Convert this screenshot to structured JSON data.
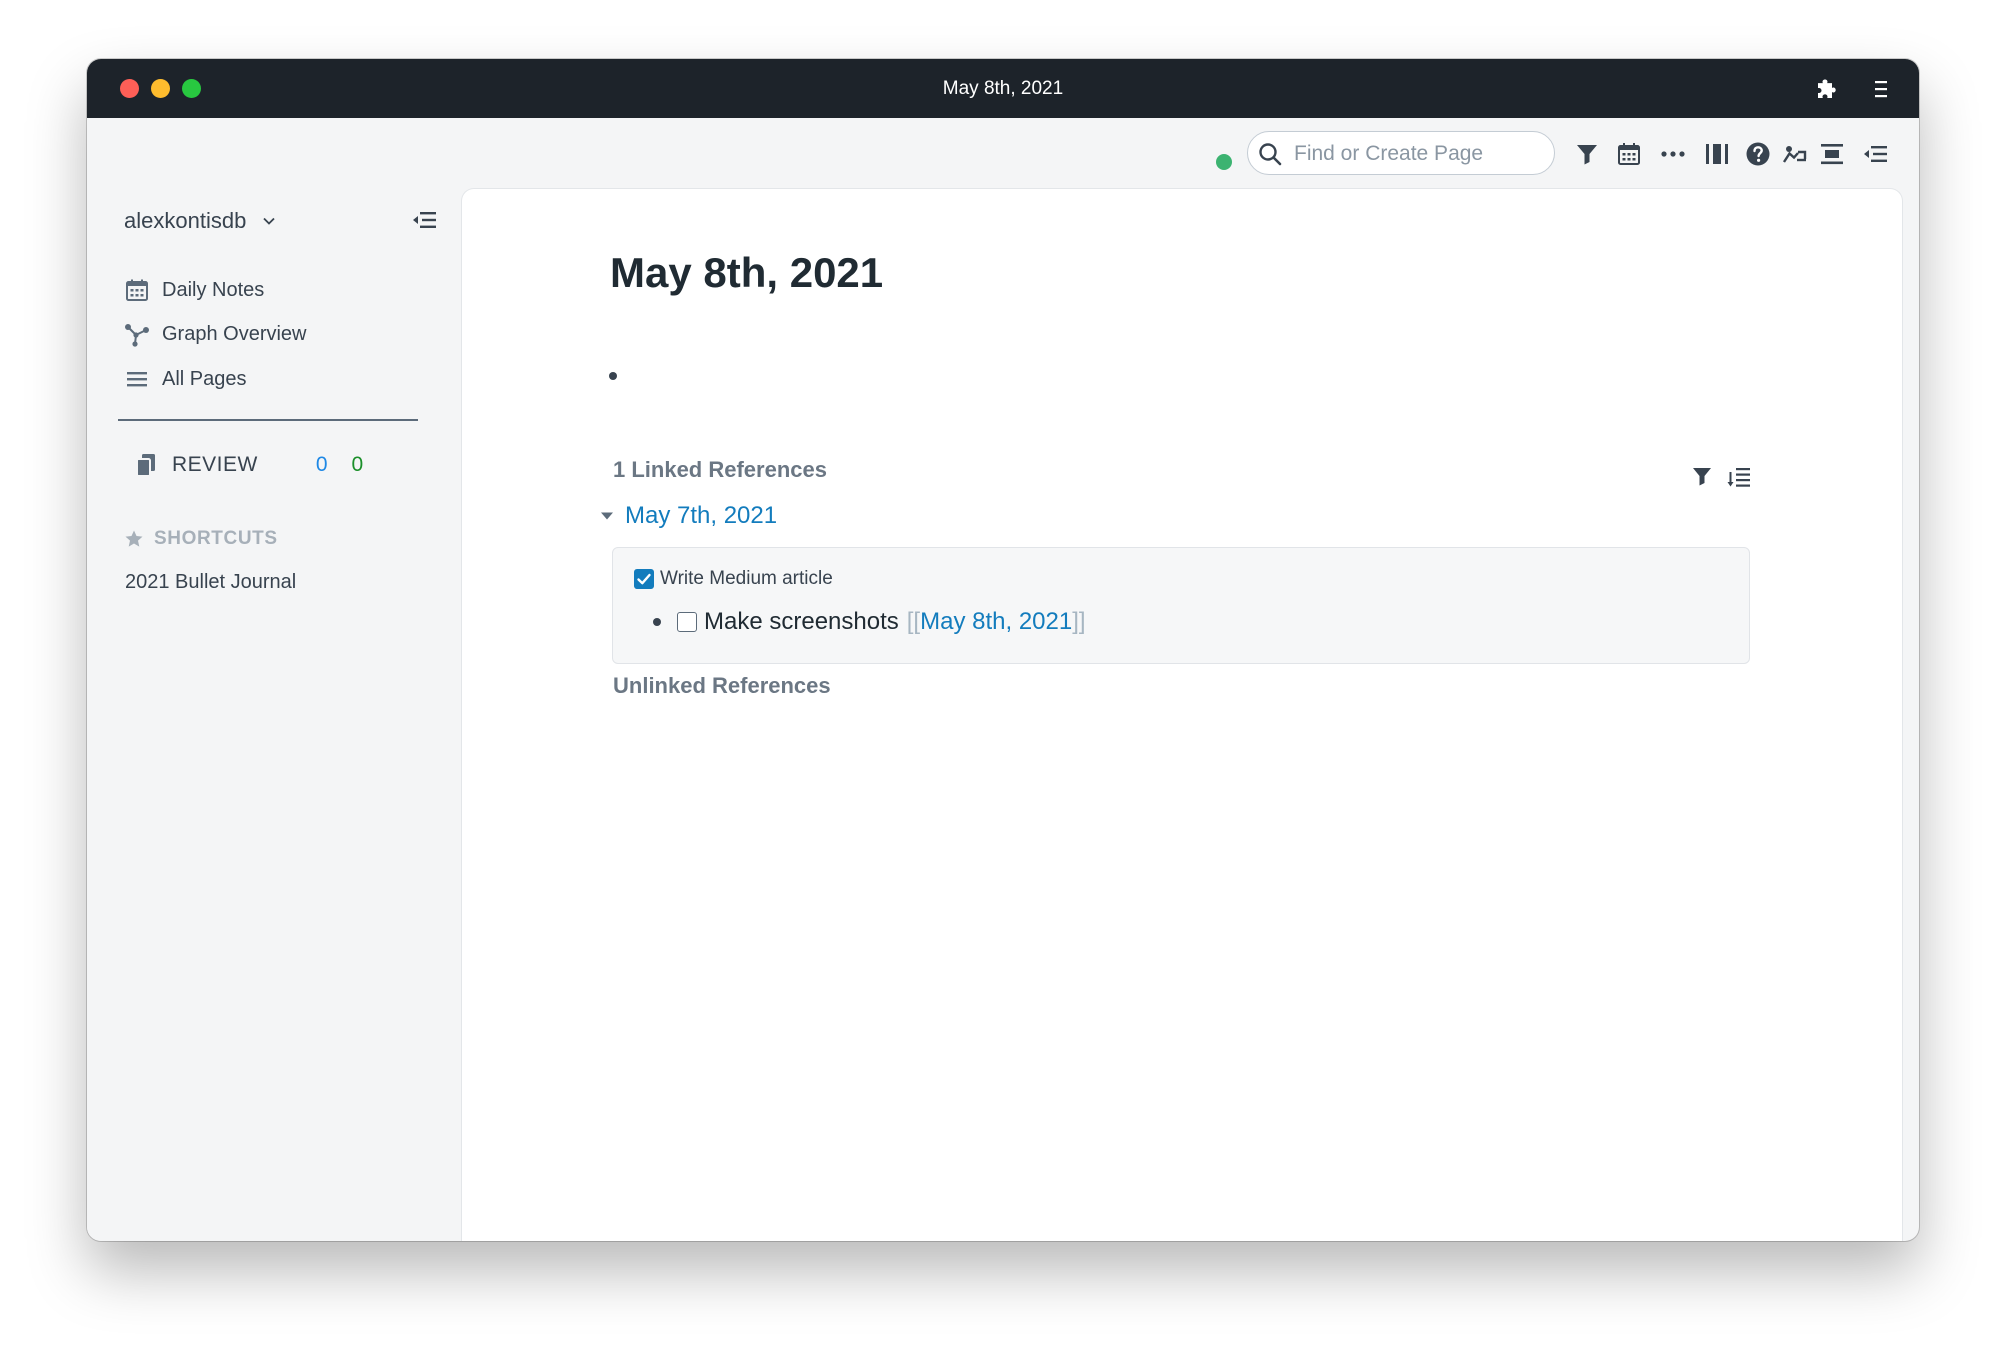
{
  "window": {
    "title": "May 8th, 2021"
  },
  "sidebar": {
    "graph_name": "alexkontisdb",
    "nav": [
      {
        "label": "Daily Notes",
        "icon": "calendar-icon"
      },
      {
        "label": "Graph Overview",
        "icon": "graph-icon"
      },
      {
        "label": "All Pages",
        "icon": "list-icon"
      }
    ],
    "review": {
      "label": "REVIEW",
      "due_count": "0",
      "new_count": "0"
    },
    "shortcuts_heading": "SHORTCUTS",
    "shortcuts": [
      "2021 Bullet Journal"
    ]
  },
  "topbar": {
    "search_placeholder": "Find or Create Page",
    "status": "synced",
    "status_color": "#3cb371"
  },
  "page": {
    "title": "May 8th, 2021",
    "linked_references_heading": "1 Linked References",
    "reference": {
      "page_link": "May 7th, 2021",
      "parent_block": {
        "checked": true,
        "text": "Write Medium article"
      },
      "child_block": {
        "checked": false,
        "text": "Make screenshots",
        "bracket_open": "[[",
        "link": "May 8th, 2021",
        "bracket_close": "]]"
      }
    },
    "unlinked_references_heading": "Unlinked References"
  },
  "colors": {
    "link": "#137cbd",
    "titlebar": "#1d232a",
    "sidebar_bg": "#f4f5f6",
    "review_due": "#1e88e5",
    "review_new": "#1b8f2a"
  }
}
